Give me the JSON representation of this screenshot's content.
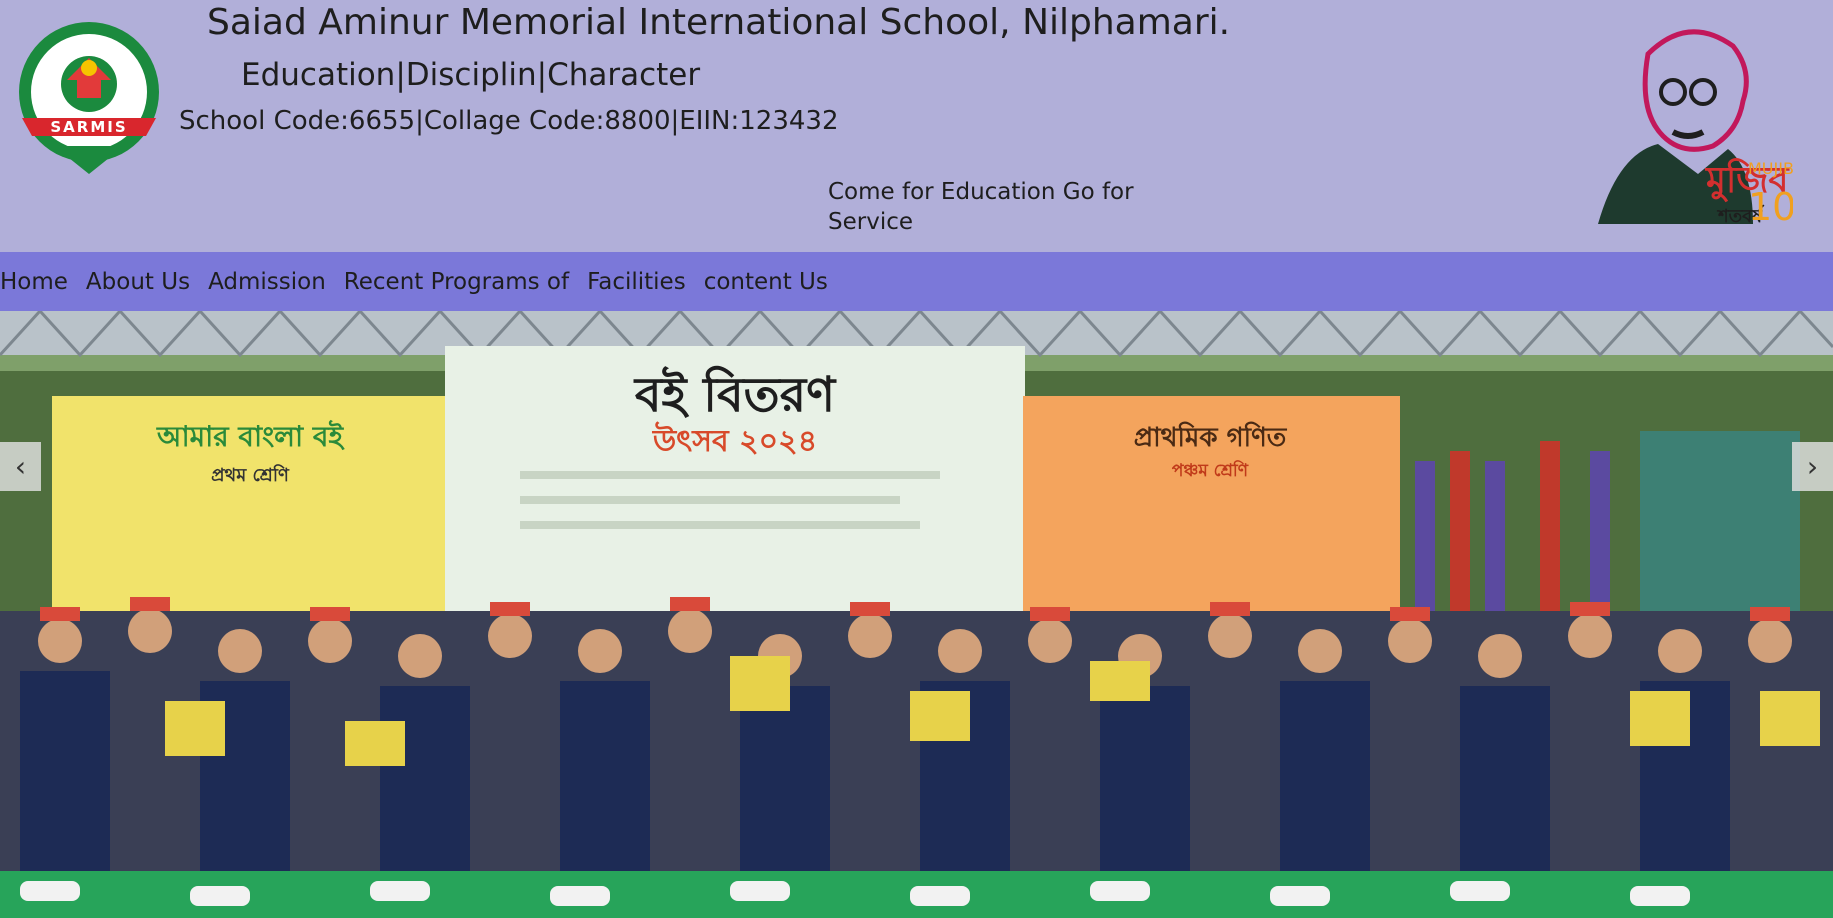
{
  "header": {
    "title": "Saiad Aminur Memorial International School, Nilphamari.",
    "motto": "Education|Disciplin|Character",
    "codes": "School Code:6655|Collage Code:8800|EIIN:123432",
    "tagline": "Come for Education Go for Service",
    "logo": {
      "ribbon_text": "SARMIS",
      "icon": "school-crest-logo"
    },
    "emblem": {
      "label_bn": "মুজিব",
      "label_sub_bn": "শতবর্ষ",
      "label_en": "MUJIB",
      "number": "100",
      "icon": "mujib-portrait-emblem"
    }
  },
  "nav": {
    "items": [
      {
        "label": "Home"
      },
      {
        "label": "About Us"
      },
      {
        "label": "Admission"
      },
      {
        "label": "Recent Programs of"
      },
      {
        "label": "Facilities"
      },
      {
        "label": "content Us"
      }
    ]
  },
  "slider": {
    "prev_label": "‹",
    "next_label": "›",
    "banners": {
      "left_title": "আমার বাংলা বই",
      "left_sub": "প্রথম শ্রেণি",
      "center_title": "বই বিতরণ",
      "center_sub": "উৎসব ২০২৪",
      "right_title": "প্রাথমিক গণিত",
      "right_sub": "পঞ্চম শ্রেণি"
    }
  },
  "colors": {
    "header_bg": "#b1afd9",
    "nav_bg": "#7b78d9",
    "text": "#1e1e1e"
  }
}
